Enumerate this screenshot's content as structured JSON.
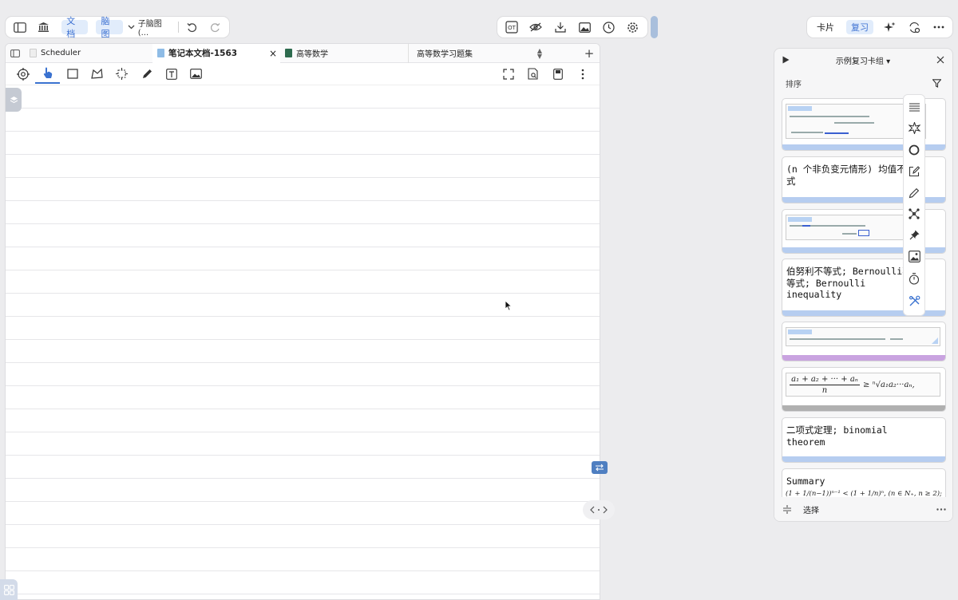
{
  "top_left_toolbar": {
    "doc_label": "文档",
    "mindmap_label": "脑图",
    "submap_label": "子脑图 (..."
  },
  "right_toolbar": {
    "cards_label": "卡片",
    "review_label": "复习"
  },
  "tabs": [
    {
      "label": "Scheduler",
      "icon_color": "#e8e8e8"
    },
    {
      "label": "笔记本文档-1563",
      "icon_color": "#8fbce6",
      "close": "×"
    },
    {
      "label": "高等数学",
      "icon_color": "#2d6b4e"
    },
    {
      "label": "高等数学习题集",
      "icon_color": ""
    }
  ],
  "panel": {
    "title": "示例复习卡组 ▾",
    "sort_label": "排序",
    "footer_label": "选择",
    "cards": [
      {
        "type": "thumb",
        "strip": "#b6cdf0"
      },
      {
        "type": "text",
        "text": "(n 个非负变元情形) 均值不等\n式",
        "strip": "#b6cdf0"
      },
      {
        "type": "thumb",
        "strip": "#b6cdf0"
      },
      {
        "type": "text",
        "text": "伯努利不等式; Bernoulli不\n等式; Bernoulli\ninequality",
        "strip": "#b6cdf0"
      },
      {
        "type": "thumb",
        "strip": "#c9a3e0"
      },
      {
        "type": "formula",
        "numerator": "a₁ + a₂ + ··· + aₙ",
        "denominator": "n",
        "rhs": "≥ ⁿ√a₁a₂···aₙ,",
        "strip": "#b0b0b0"
      },
      {
        "type": "text",
        "text": "二项式定理; binomial\ntheorem",
        "strip": "#b6cdf0"
      },
      {
        "type": "summary",
        "text": "Summary",
        "formula": "(1 + 1/(n−1))ⁿ⁻¹ < (1 + 1/n)ⁿ, (n ∈ N₊, n ≥ 2);",
        "strip": ""
      }
    ]
  }
}
